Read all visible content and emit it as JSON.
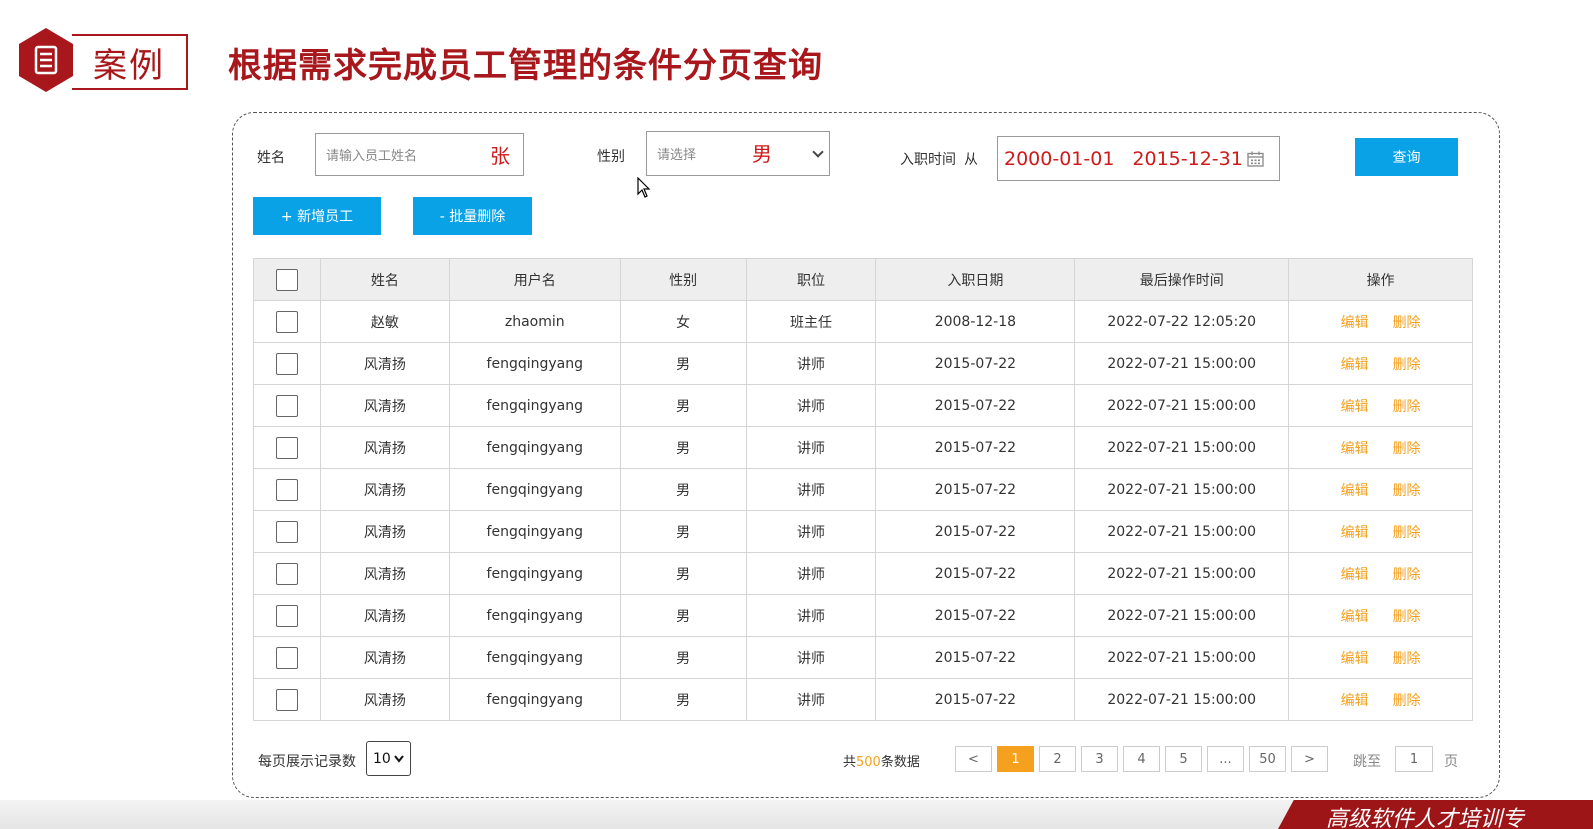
{
  "header": {
    "badge_label": "案例",
    "title": "根据需求完成员工管理的条件分页查询"
  },
  "search": {
    "name_label": "姓名",
    "name_placeholder": "请输入员工姓名",
    "name_hint": "张",
    "gender_label": "性别",
    "gender_placeholder": "请选择",
    "gender_hint": "男",
    "date_label": "入职时间",
    "date_from_label": "从",
    "date_start": "2000-01-01",
    "date_end": "2015-12-31",
    "query_button": "查询"
  },
  "actions": {
    "add_button": "+ 新增员工",
    "batch_delete_button": "- 批量删除"
  },
  "table": {
    "columns": [
      "姓名",
      "用户名",
      "性别",
      "职位",
      "入职日期",
      "最后操作时间",
      "操作"
    ],
    "edit_label": "编辑",
    "delete_label": "删除",
    "rows": [
      {
        "name": "赵敏",
        "username": "zhaomin",
        "gender": "女",
        "position": "班主任",
        "entry_date": "2008-12-18",
        "last_op": "2022-07-22 12:05:20"
      },
      {
        "name": "风清扬",
        "username": "fengqingyang",
        "gender": "男",
        "position": "讲师",
        "entry_date": "2015-07-22",
        "last_op": "2022-07-21 15:00:00"
      },
      {
        "name": "风清扬",
        "username": "fengqingyang",
        "gender": "男",
        "position": "讲师",
        "entry_date": "2015-07-22",
        "last_op": "2022-07-21 15:00:00"
      },
      {
        "name": "风清扬",
        "username": "fengqingyang",
        "gender": "男",
        "position": "讲师",
        "entry_date": "2015-07-22",
        "last_op": "2022-07-21 15:00:00"
      },
      {
        "name": "风清扬",
        "username": "fengqingyang",
        "gender": "男",
        "position": "讲师",
        "entry_date": "2015-07-22",
        "last_op": "2022-07-21 15:00:00"
      },
      {
        "name": "风清扬",
        "username": "fengqingyang",
        "gender": "男",
        "position": "讲师",
        "entry_date": "2015-07-22",
        "last_op": "2022-07-21 15:00:00"
      },
      {
        "name": "风清扬",
        "username": "fengqingyang",
        "gender": "男",
        "position": "讲师",
        "entry_date": "2015-07-22",
        "last_op": "2022-07-21 15:00:00"
      },
      {
        "name": "风清扬",
        "username": "fengqingyang",
        "gender": "男",
        "position": "讲师",
        "entry_date": "2015-07-22",
        "last_op": "2022-07-21 15:00:00"
      },
      {
        "name": "风清扬",
        "username": "fengqingyang",
        "gender": "男",
        "position": "讲师",
        "entry_date": "2015-07-22",
        "last_op": "2022-07-21 15:00:00"
      },
      {
        "name": "风清扬",
        "username": "fengqingyang",
        "gender": "男",
        "position": "讲师",
        "entry_date": "2015-07-22",
        "last_op": "2022-07-21 15:00:00"
      }
    ]
  },
  "pagination": {
    "page_size_label": "每页展示记录数",
    "page_size": "10",
    "total_prefix": "共",
    "total_count": "500",
    "total_suffix": "条数据",
    "prev": "<",
    "pages": [
      "1",
      "2",
      "3",
      "4",
      "5",
      "...",
      "50"
    ],
    "current_page": "1",
    "next": ">",
    "jump_label": "跳至",
    "jump_value": "1",
    "page_unit": "页"
  },
  "banner": {
    "text": "高级软件人才培训专"
  },
  "colors": {
    "brand_red": "#a8171c",
    "hint_red": "#d01919",
    "button_blue": "#0aa2e6",
    "action_orange": "#f4a020"
  }
}
